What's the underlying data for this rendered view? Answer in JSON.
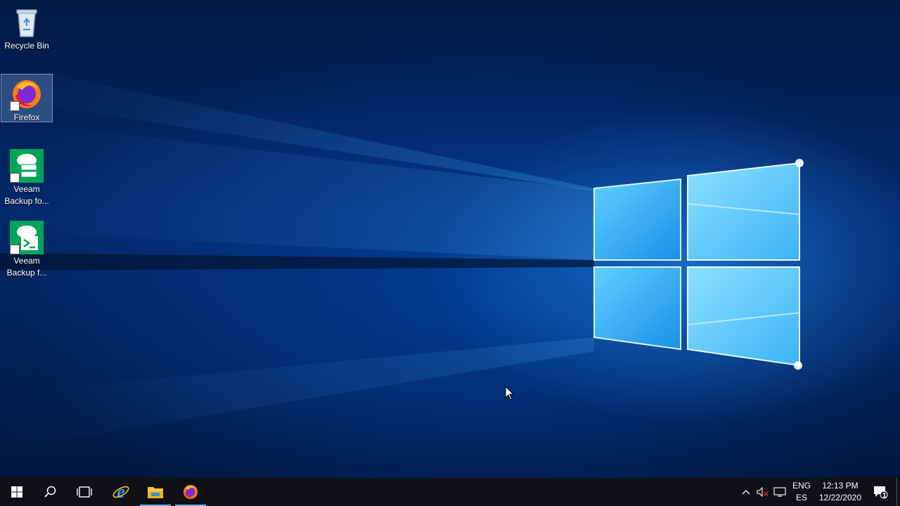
{
  "desktop": {
    "icons": [
      {
        "label": "Recycle Bin",
        "icon": "recycle-bin-icon"
      },
      {
        "label": "Firefox",
        "icon": "firefox-icon",
        "selected": true
      },
      {
        "label": "Veeam\nBackup fo...",
        "icon": "veeam-backup-icon"
      },
      {
        "label": "Veeam\nBackup f...",
        "icon": "veeam-backup-shell-icon"
      }
    ]
  },
  "taskbar": {
    "start_icon": "windows-logo-icon",
    "search_icon": "search-icon",
    "task_view_icon": "task-view-icon",
    "pinned": [
      {
        "name": "Internet Explorer",
        "icon": "internet-explorer-icon"
      },
      {
        "name": "File Explorer",
        "icon": "file-explorer-icon",
        "active": true
      },
      {
        "name": "Firefox",
        "icon": "firefox-icon",
        "active": true
      }
    ],
    "tray": {
      "chevron_icon": "chevron-up-icon",
      "volume_icon": "volume-muted-icon",
      "network_icon": "network-icon",
      "language_top": "ENG",
      "language_bottom": "ES",
      "time": "12:13 PM",
      "date": "12/22/2020",
      "notification_icon": "action-center-icon",
      "notification_count": "1"
    }
  },
  "colors": {
    "taskbar_bg": "#101114",
    "accent": "#76b9ed",
    "veeam_green": "#00a35a"
  }
}
